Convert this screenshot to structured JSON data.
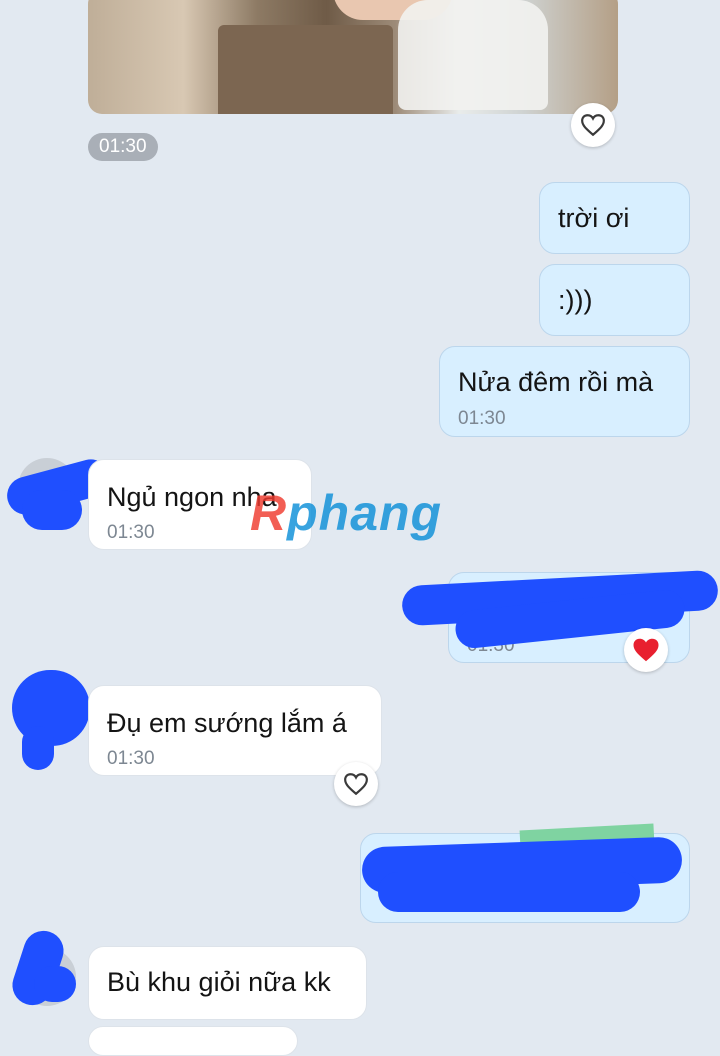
{
  "chat": {
    "photo_time": "01:30",
    "messages": [
      {
        "text": "trời ơi"
      },
      {
        "text": ":)))"
      },
      {
        "text": "Nửa đêm rồi mà",
        "time": "01:30"
      },
      {
        "text": "Ngủ ngon nha",
        "time": "01:30"
      },
      {
        "time": "01:30"
      },
      {
        "text": "Đụ em sướng lắm á",
        "time": "01:30"
      },
      {
        "text": "Bù khu giỏi nữa kk"
      }
    ]
  },
  "watermark": {
    "first": "R",
    "rest": "phang"
  },
  "icons": {
    "heart_outline": "heart-outline-icon",
    "heart_filled": "heart-filled-icon",
    "heart_color": "#e8202f"
  }
}
